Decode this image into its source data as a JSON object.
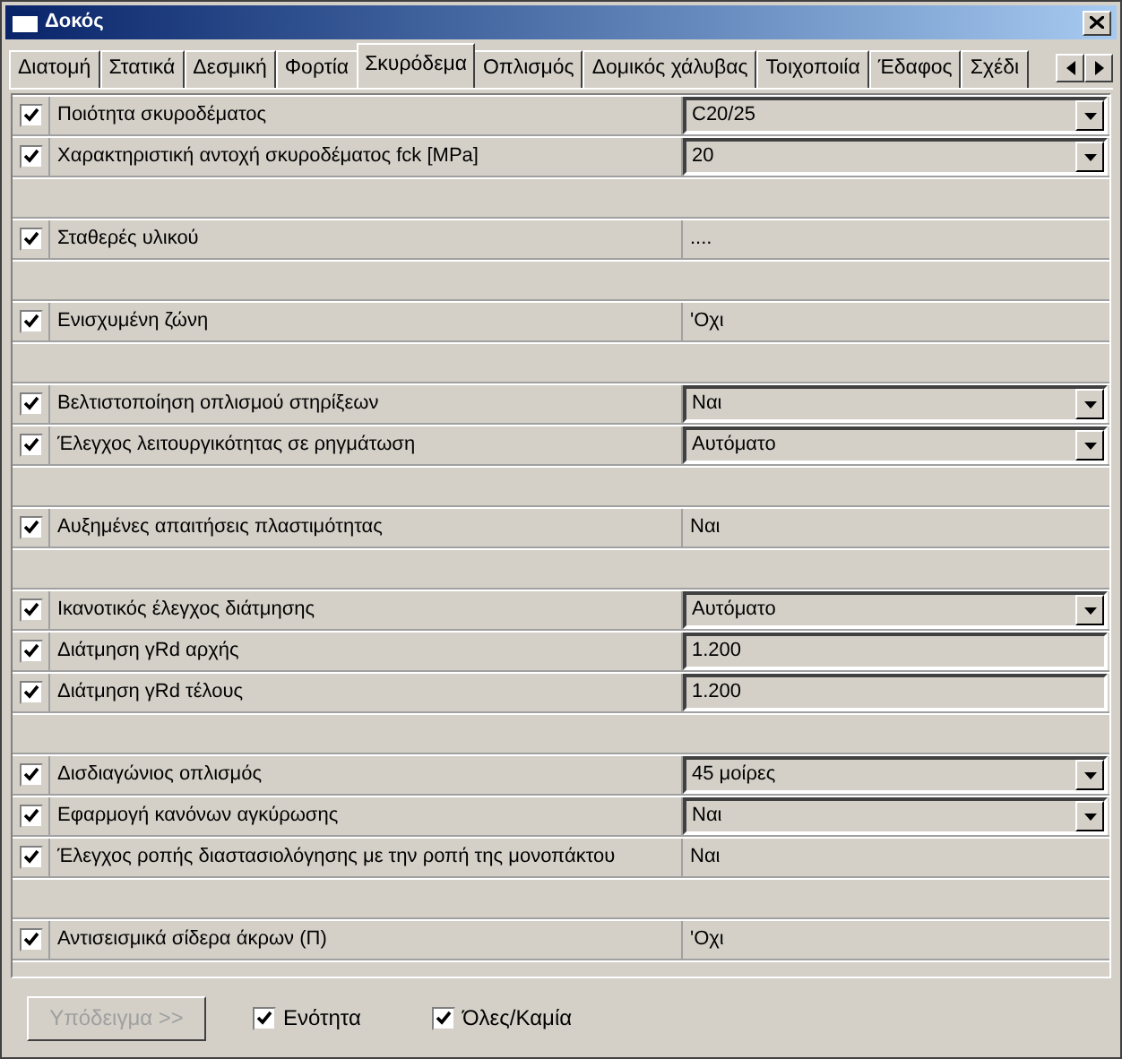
{
  "window": {
    "title": "Δοκός"
  },
  "tabs": [
    {
      "label": "Διατομή",
      "selected": false
    },
    {
      "label": "Στατικά",
      "selected": false
    },
    {
      "label": "Δεσμική",
      "selected": false
    },
    {
      "label": "Φορτία",
      "selected": false
    },
    {
      "label": "Σκυρόδεμα",
      "selected": true
    },
    {
      "label": "Οπλισμός",
      "selected": false
    },
    {
      "label": "Δομικός χάλυβας",
      "selected": false
    },
    {
      "label": "Τοιχοποιία",
      "selected": false
    },
    {
      "label": "Έδαφος",
      "selected": false
    },
    {
      "label": "Σχέδι",
      "selected": false
    }
  ],
  "rows": [
    {
      "kind": "dropdown",
      "checked": true,
      "label": "Ποιότητα σκυροδέματος",
      "value": "C20/25"
    },
    {
      "kind": "dropdown",
      "checked": true,
      "label": "Χαρακτηριστική αντοχή σκυροδέματος fck [MPa]",
      "value": "20"
    },
    {
      "kind": "blank"
    },
    {
      "kind": "static",
      "checked": true,
      "label": "Σταθερές υλικού",
      "value": "...."
    },
    {
      "kind": "blank"
    },
    {
      "kind": "static",
      "checked": true,
      "label": "Ενισχυμένη ζώνη",
      "value": "'Οχι"
    },
    {
      "kind": "blank"
    },
    {
      "kind": "dropdown",
      "checked": true,
      "label": "Βελτιστοποίηση οπλισμού στηρίξεων",
      "value": "Ναι"
    },
    {
      "kind": "dropdown",
      "checked": true,
      "label": "Έλεγχος λειτουργικότητας σε ρηγμάτωση",
      "value": "Αυτόματο"
    },
    {
      "kind": "blank"
    },
    {
      "kind": "static",
      "checked": true,
      "label": "Αυξημένες απαιτήσεις πλαστιμότητας",
      "value": "Ναι"
    },
    {
      "kind": "blank"
    },
    {
      "kind": "dropdown",
      "checked": true,
      "label": "Ικανοτικός έλεγχος διάτμησης",
      "value": "Αυτόματο"
    },
    {
      "kind": "edit",
      "checked": true,
      "label": "Διάτμηση γRd αρχής",
      "value": "1.200"
    },
    {
      "kind": "edit",
      "checked": true,
      "label": "Διάτμηση γRd τέλους",
      "value": "1.200"
    },
    {
      "kind": "blank"
    },
    {
      "kind": "dropdown",
      "checked": true,
      "label": "Δισδιαγώνιος οπλισμός",
      "value": "45 μοίρες"
    },
    {
      "kind": "dropdown",
      "checked": true,
      "label": "Εφαρμογή κανόνων αγκύρωσης",
      "value": "Ναι"
    },
    {
      "kind": "static",
      "checked": true,
      "label": "Έλεγχος ροπής διαστασιολόγησης με την ροπή της μονοπάκτου",
      "value": "Ναι"
    },
    {
      "kind": "blank"
    },
    {
      "kind": "static",
      "checked": true,
      "label": "Αντισεισμικά σίδερα άκρων (Π)",
      "value": "'Οχι"
    },
    {
      "kind": "blank"
    }
  ],
  "footer": {
    "button": {
      "label": "Υπόδειγμα >>",
      "disabled": true
    },
    "checkboxes": [
      {
        "label": "Ενότητα",
        "checked": true
      },
      {
        "label": "Όλες/Καμία",
        "checked": true
      }
    ]
  }
}
